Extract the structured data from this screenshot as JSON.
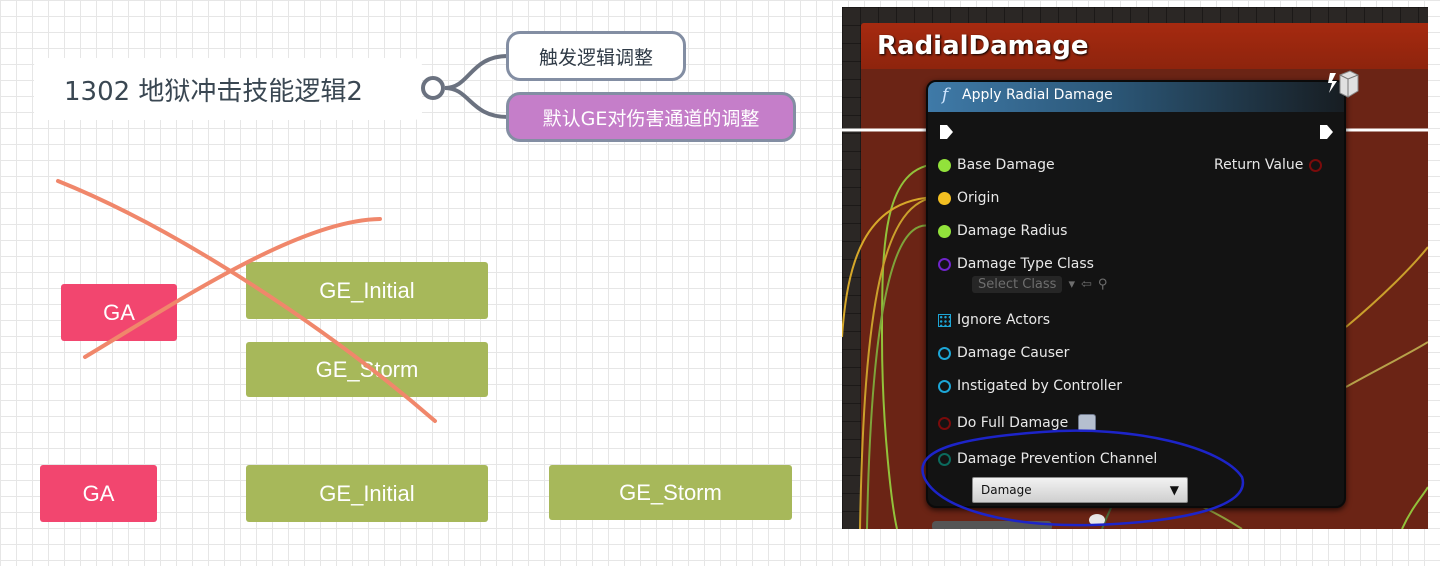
{
  "mindmap": {
    "root": "1302 地狱冲击技能逻辑2",
    "subtopics": [
      "触发逻辑调整",
      "默认GE对伤害通道的调整"
    ]
  },
  "boxes": {
    "ga_top": "GA",
    "ge_initial_top": "GE_Initial",
    "ge_storm_top": "GE_Storm",
    "ga_bottom": "GA",
    "ge_initial_bottom": "GE_Initial",
    "ge_storm_bottom": "GE_Storm"
  },
  "colors": {
    "ga": "#f2466f",
    "ge": "#a7b85a",
    "cross_out": "#f0876b",
    "highlight_topic": "#c57ec9",
    "annotation_circle": "#1d24c9"
  },
  "unreal": {
    "comment_title": "RadialDamage",
    "node_title": "Apply Radial Damage",
    "function_glyph": "f",
    "pins": {
      "base_damage": "Base Damage",
      "origin": "Origin",
      "damage_radius": "Damage Radius",
      "damage_type_class": "Damage Type Class",
      "ignore_actors": "Ignore Actors",
      "damage_causer": "Damage Causer",
      "instigated_by_controller": "Instigated by Controller",
      "do_full_damage": "Do Full Damage",
      "damage_prevention_channel": "Damage Prevention Channel",
      "return_value": "Return Value"
    },
    "select_class_label": "Select Class",
    "channel_value": "Damage"
  },
  "icons": [
    "function-icon",
    "lightning-cube-icon",
    "exec-pin-icon",
    "dropdown-arrow-icon",
    "checkbox-icon",
    "magnifier-icon",
    "arrow-left-icon"
  ]
}
